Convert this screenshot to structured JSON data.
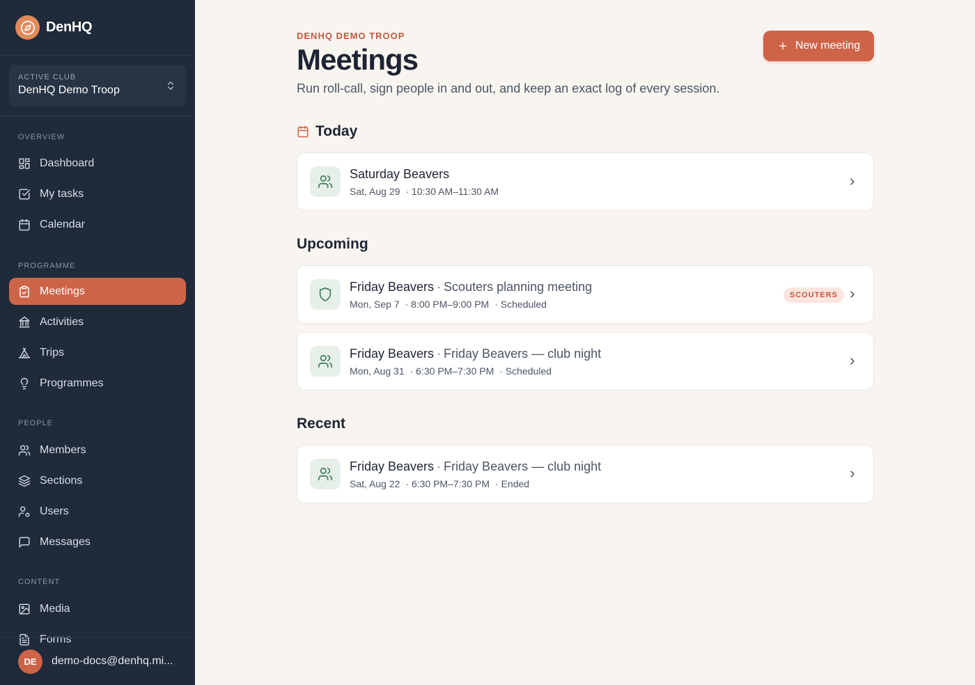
{
  "app": {
    "name": "DenHQ",
    "logo_icon": "compass-icon",
    "accent": "#cd6448",
    "sidebar_bg": "#1f2a3a"
  },
  "club": {
    "label": "Active club",
    "name": "DenHQ Demo Troop"
  },
  "nav": {
    "overview": {
      "heading": "Overview",
      "items": [
        {
          "label": "Dashboard",
          "icon": "dashboard-icon"
        },
        {
          "label": "My tasks",
          "icon": "tasks-icon"
        },
        {
          "label": "Calendar",
          "icon": "calendar-icon"
        }
      ]
    },
    "programme": {
      "heading": "Programme",
      "items": [
        {
          "label": "Meetings",
          "icon": "clipboard-icon",
          "active": true
        },
        {
          "label": "Activities",
          "icon": "activities-icon"
        },
        {
          "label": "Trips",
          "icon": "tent-icon"
        },
        {
          "label": "Programmes",
          "icon": "lightbulb-icon"
        }
      ]
    },
    "people": {
      "heading": "People",
      "items": [
        {
          "label": "Members",
          "icon": "members-icon"
        },
        {
          "label": "Sections",
          "icon": "layers-icon"
        },
        {
          "label": "Users",
          "icon": "user-cog-icon"
        },
        {
          "label": "Messages",
          "icon": "message-icon"
        }
      ]
    },
    "content": {
      "heading": "Content",
      "items": [
        {
          "label": "Media",
          "icon": "image-icon"
        },
        {
          "label": "Forms",
          "icon": "form-icon"
        }
      ]
    }
  },
  "user": {
    "initials": "DE",
    "email": "demo-docs@denhq.mi..."
  },
  "header": {
    "eyebrow": "DenHQ Demo Troop",
    "title": "Meetings",
    "subtitle": "Run roll-call, sign people in and out, and keep an exact log of every session.",
    "new_button": "New meeting"
  },
  "sections": {
    "today": {
      "title": "Today",
      "cards": [
        {
          "name": "Saturday Beavers",
          "date": "Sat, Aug 29",
          "time": "· 10:30 AM–11:30 AM",
          "icon": "members-icon"
        }
      ]
    },
    "upcoming": {
      "title": "Upcoming",
      "cards": [
        {
          "name": "Friday Beavers",
          "dot": "·",
          "subtitle": "Scouters planning meeting",
          "date": "Mon, Sep 7",
          "time": "· 8:00 PM–9:00 PM",
          "status": "· Scheduled",
          "badge": "Scouters",
          "icon": "shield-icon"
        },
        {
          "name": "Friday Beavers",
          "dot": "·",
          "subtitle": "Friday Beavers — club night",
          "date": "Mon, Aug 31",
          "time": "· 6:30 PM–7:30 PM",
          "status": "· Scheduled",
          "icon": "members-icon"
        }
      ]
    },
    "recent": {
      "title": "Recent",
      "cards": [
        {
          "name": "Friday Beavers",
          "dot": "·",
          "subtitle": "Friday Beavers — club night",
          "date": "Sat, Aug 22",
          "time": "· 6:30 PM–7:30 PM",
          "status": "· Ended",
          "icon": "members-icon"
        }
      ]
    }
  }
}
